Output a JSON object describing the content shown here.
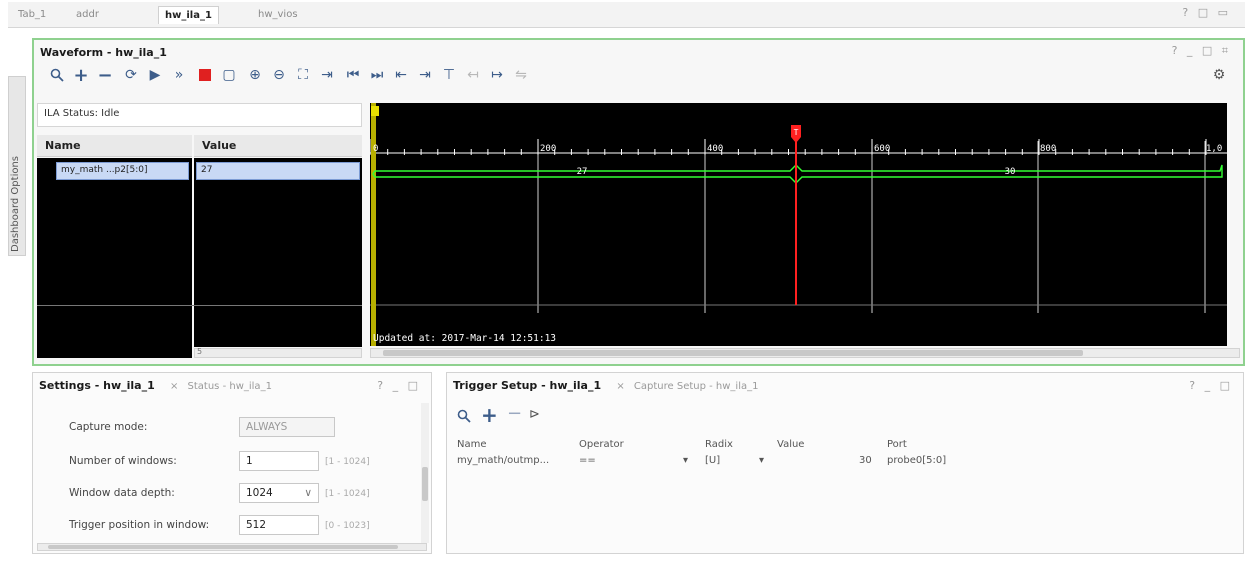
{
  "top_tabs": [
    {
      "label": "Tab_1"
    },
    {
      "label": "addr"
    },
    {
      "label": "hw_ila_1"
    },
    {
      "label": "hw_vios"
    }
  ],
  "dashboard_label": "Dashboard Options",
  "waveform": {
    "title": "Waveform - hw_ila_1",
    "ila_status": "ILA Status: Idle",
    "col_name": "Name",
    "col_value": "Value",
    "signal_name": "my_math ...p2[5:0]",
    "signal_value": "27",
    "marker_label": "T",
    "ruler_ticks": [
      "0",
      "200",
      "400",
      "600",
      "800",
      "1,0"
    ],
    "bus_value_left": "27",
    "bus_value_right": "30",
    "updated_text": "Updated at: 2017-Mar-14 12:51:13",
    "scroll_left_label": "5"
  },
  "settings": {
    "title": "Settings - hw_ila_1",
    "status_tab": "Status - hw_ila_1",
    "rows": [
      {
        "label": "Capture mode:",
        "value": "ALWAYS",
        "range": ""
      },
      {
        "label": "Number of windows:",
        "value": "1",
        "range": "[1 - 1024]"
      },
      {
        "label": "Window data depth:",
        "value": "1024",
        "range": "[1 - 1024]"
      },
      {
        "label": "Trigger position in window:",
        "value": "512",
        "range": "[0 - 1023]"
      }
    ]
  },
  "trigger": {
    "title": "Trigger Setup - hw_ila_1",
    "capture_tab": "Capture Setup - hw_ila_1",
    "headers": [
      "Name",
      "Operator",
      "Radix",
      "Value",
      "Port"
    ],
    "row": {
      "name": "my_math/outmp...",
      "operator": "==",
      "radix": "[U]",
      "value": "30",
      "port": "probe0[5:0]"
    }
  }
}
